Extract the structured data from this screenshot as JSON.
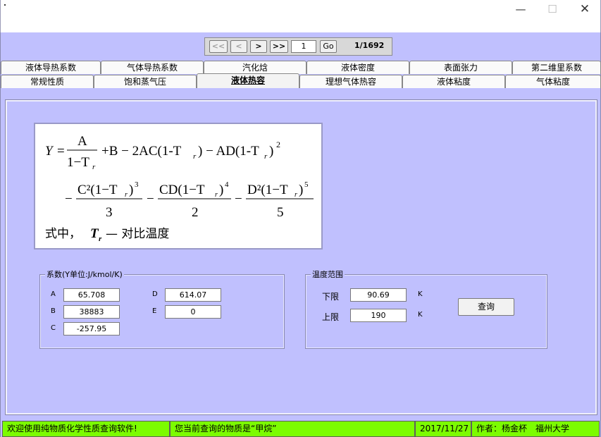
{
  "window": {
    "min_glyph": "—",
    "max_glyph": "☐",
    "close_glyph": "✕"
  },
  "nav": {
    "first_label": "<<",
    "prev_label": "<",
    "next_label": ">",
    "last_label": ">>",
    "page_value": "1",
    "go_label": "Go",
    "page_info": "1/1692"
  },
  "tabs_top": [
    "液体导热系数",
    "气体导热系数",
    "汽化焓",
    "液体密度",
    "表面张力",
    "第二维里系数"
  ],
  "tabs_bottom": [
    "常规性质",
    "饱和蒸气压",
    "液体热容",
    "理想气体热容",
    "液体粘度",
    "气体粘度"
  ],
  "active_tab": "液体热容",
  "formula": {
    "lhs": "Y",
    "line1_term1_num": "A",
    "line1_term1_den": "1−T",
    "line1_rest": "+B − 2AC(1-T",
    "line1_mid": ") − AD(1-T",
    "line1_exp": "2",
    "line2_t1_num": "C²(1−T",
    "line2_t1_exp": "3",
    "line2_t1_den": "3",
    "line2_t2_num": "CD(1−T",
    "line2_t2_exp": "4",
    "line2_t2_den": "2",
    "line2_t3_num": "D²(1−T",
    "line2_t3_exp": "5",
    "line2_t3_den": "5",
    "note_prefix": "式中，",
    "note_var": "T",
    "note_sub": "r",
    "note_text": "— 对比温度",
    "sub_r": "r"
  },
  "coefficients": {
    "legend": "系数(Y单位:J/kmol/K)",
    "items": [
      {
        "label": "A",
        "value": "65.708"
      },
      {
        "label": "B",
        "value": "38883"
      },
      {
        "label": "C",
        "value": "-257.95"
      },
      {
        "label": "D",
        "value": "614.07"
      },
      {
        "label": "E",
        "value": "0"
      }
    ]
  },
  "temperature": {
    "legend": "温度范围",
    "lower_label": "下限",
    "lower_value": "90.69",
    "upper_label": "上限",
    "upper_value": "190",
    "unit": "K",
    "query_label": "查询"
  },
  "status": {
    "welcome": "欢迎使用纯物质化学性质查询软件!",
    "current": "您当前查询的物质是“甲烷”",
    "date": "2017/11/27",
    "author": "作者：杨金杯　福州大学"
  },
  "colors": {
    "client_bg": "#c0c0fe",
    "status_bg": "#7cfc00"
  }
}
